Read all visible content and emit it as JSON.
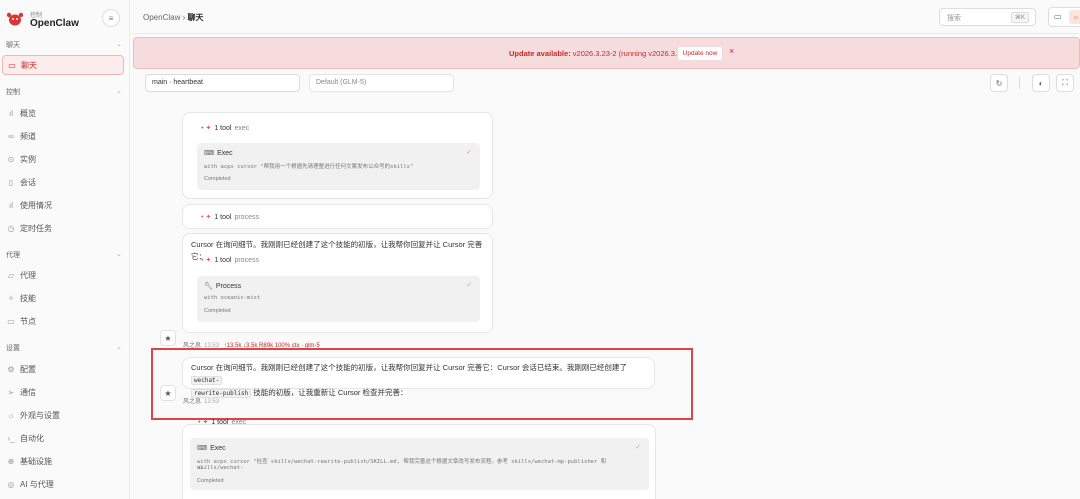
{
  "brand": {
    "subtitle": "控制",
    "name": "OpenClaw"
  },
  "sidebar": {
    "chat_section": "聊天",
    "chat_item": "聊天",
    "control_section": "控制",
    "control_items": [
      "概览",
      "频道",
      "实例",
      "会话",
      "使用情况",
      "定时任务"
    ],
    "agent_section": "代理",
    "agent_items": [
      "代理",
      "技能",
      "节点"
    ],
    "settings_section": "设置",
    "settings_items": [
      "配置",
      "通信",
      "外观与设置",
      "自动化",
      "基础设施",
      "AI 与代理"
    ]
  },
  "header": {
    "breadcrumb_root": "OpenClaw",
    "breadcrumb_sep": "›",
    "breadcrumb_current": "聊天",
    "search_placeholder": "搜索",
    "search_shortcut": "⌘K"
  },
  "banner": {
    "title": "Update available:",
    "detail": "v2026.3.23-2 (running v2026.3.13).",
    "button": "Update now",
    "close": "×"
  },
  "toolbar": {
    "session": "main · heartbeat",
    "model": "Default (GLM-5)"
  },
  "messages": {
    "card1": {
      "tool_count": "1 tool",
      "tool_kind": "exec",
      "box_title": "Exec",
      "box_cmd": "with acpx cursor \"帮我用一个根据先清理整进行任何文案发布公众号的skills\"",
      "box_status": "Completed"
    },
    "card2": {
      "tool_count": "1 tool",
      "tool_kind": "process"
    },
    "card3": {
      "text": "Cursor 在询问细节。我刚刚已经创建了这个技能的初版，让我帮你回复并让 Cursor 完善它：",
      "tool_count": "1 tool",
      "tool_kind": "process",
      "box_title": "Process",
      "box_cmd": "with oceanic-mist",
      "box_status": "Completed"
    },
    "meta1": {
      "author": "风之息",
      "time": "13:53",
      "extra": "↑13.5k ↓3.5k  R89k  100% ctx  ·  glm-5"
    },
    "highlighted": {
      "text_before": "Cursor 在询问细节。我刚刚已经创建了这个技能的初版，让我帮你回复并让 Cursor 完善它：Cursor 会话已结束。我刚刚已经创建了",
      "code1": "wechat-",
      "code2": "rewrite-publish",
      "text_after": "技能的初版，让我重新让 Cursor 检查并完善：",
      "author": "风之息",
      "time": "13:53"
    },
    "card5": {
      "tool_count": "1 tool",
      "tool_kind": "exec",
      "box_title": "Exec",
      "box_cmd_line1": "with acpx cursor \"检查 skills/wechat-rewrite-publish/SKILL.md, 帮我完善这个根据文章改写发布流程。参考 skills/wechat-mp-publisher 和 skills/wechat-",
      "box_cmd_line2": "a…",
      "box_status": "Completed"
    }
  },
  "icons": {
    "logo": "openclaw-logo",
    "accent": "#c62828"
  }
}
